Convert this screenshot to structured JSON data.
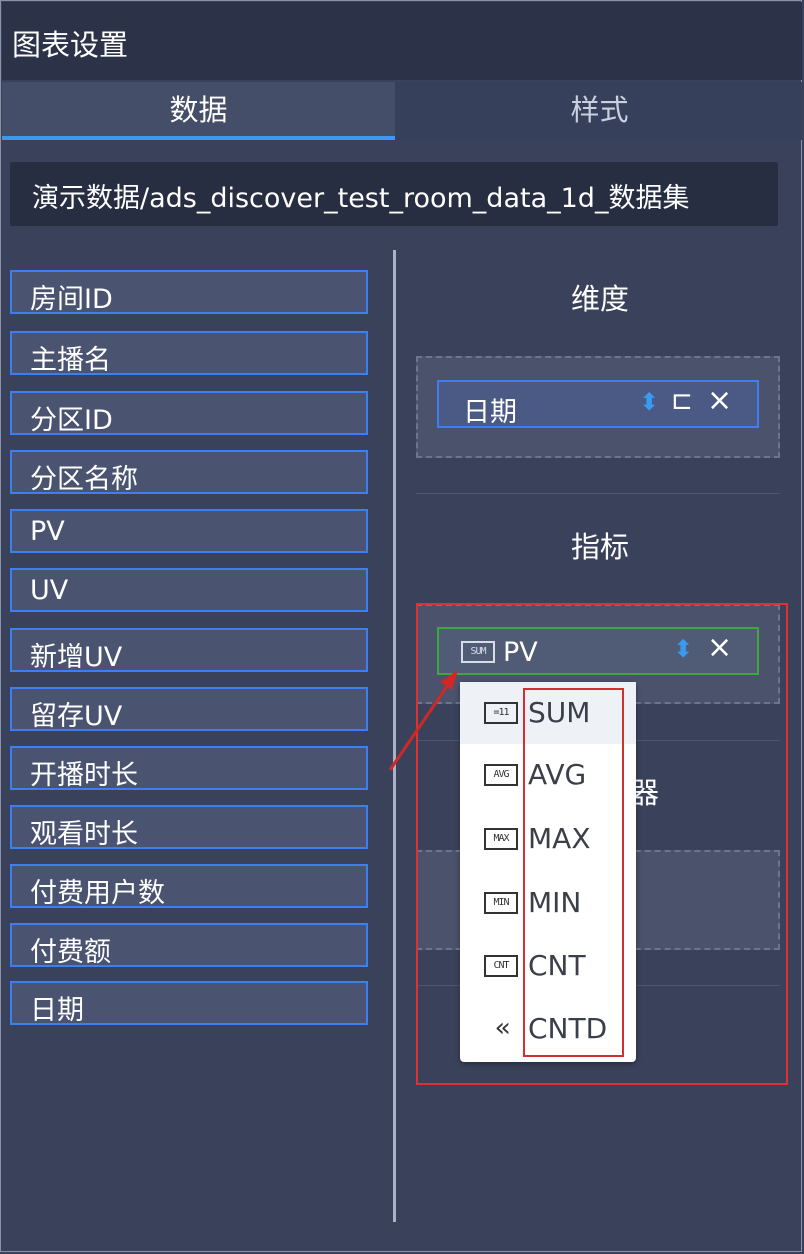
{
  "panel": {
    "title": "图表设置"
  },
  "tabs": [
    {
      "label": "数据"
    },
    {
      "label": "样式"
    }
  ],
  "dataset": {
    "name": "演示数据/ads_discover_test_room_data_1d_数据集"
  },
  "fields": [
    {
      "label": "房间ID"
    },
    {
      "label": "主播名"
    },
    {
      "label": "分区ID"
    },
    {
      "label": "分区名称"
    },
    {
      "label": "PV"
    },
    {
      "label": "UV"
    },
    {
      "label": "新增UV"
    },
    {
      "label": "留存UV"
    },
    {
      "label": "开播时长"
    },
    {
      "label": "观看时长"
    },
    {
      "label": "付费用户数"
    },
    {
      "label": "付费额"
    },
    {
      "label": "日期"
    }
  ],
  "dimension": {
    "title": "维度",
    "item": {
      "label": "日期"
    }
  },
  "metric": {
    "title": "指标",
    "item": {
      "label": "PV",
      "agg_badge": "SUM"
    }
  },
  "filter": {
    "title_partial": "器"
  },
  "agg_menu": {
    "items": [
      {
        "label": "SUM",
        "icon": "sum-icon",
        "highlighted": true
      },
      {
        "label": "AVG",
        "icon": "avg-icon"
      },
      {
        "label": "MAX",
        "icon": "max-icon"
      },
      {
        "label": "MIN",
        "icon": "min-icon"
      },
      {
        "label": "CNT",
        "icon": "cnt-icon"
      },
      {
        "label": "CNTD",
        "icon": "cntd-icon"
      }
    ]
  },
  "colors": {
    "accent": "#3a9af0",
    "field_border": "#3d7ff0",
    "metric_border": "#3fa73f",
    "annotation": "#e03030"
  }
}
